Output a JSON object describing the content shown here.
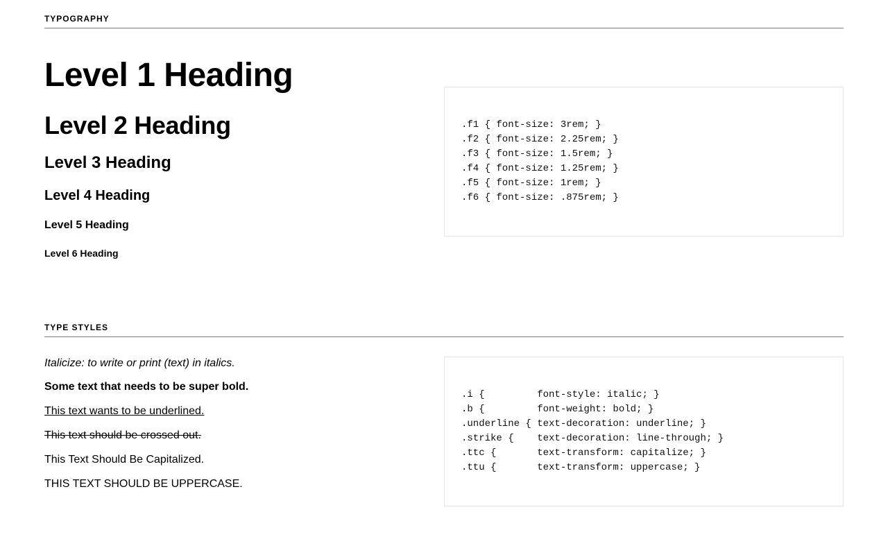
{
  "sections": {
    "typography": {
      "label": "Typography",
      "headings": {
        "h1": "Level 1 Heading",
        "h2": "Level 2 Heading",
        "h3": "Level 3 Heading",
        "h4": "Level 4 Heading",
        "h5": "Level 5 Heading",
        "h6": "Level 6 Heading"
      },
      "code": ".f1 { font-size: 3rem; }\n.f2 { font-size: 2.25rem; }\n.f3 { font-size: 1.5rem; }\n.f4 { font-size: 1.25rem; }\n.f5 { font-size: 1rem; }\n.f6 { font-size: .875rem; }"
    },
    "type_styles": {
      "label": "Type Styles",
      "examples": {
        "italic": "Italicize: to write or print (text) in italics.",
        "bold": "Some text that needs to be super bold.",
        "underline": "This text wants to be underlined.",
        "strike": "This text should be crossed out.",
        "capitalize": "this text should be capitalized.",
        "uppercase": "This text should be uppercase."
      },
      "code": ".i {         font-style: italic; }\n.b {         font-weight: bold; }\n.underline { text-decoration: underline; }\n.strike {    text-decoration: line-through; }\n.ttc {       text-transform: capitalize; }\n.ttu {       text-transform: uppercase; }"
    }
  }
}
